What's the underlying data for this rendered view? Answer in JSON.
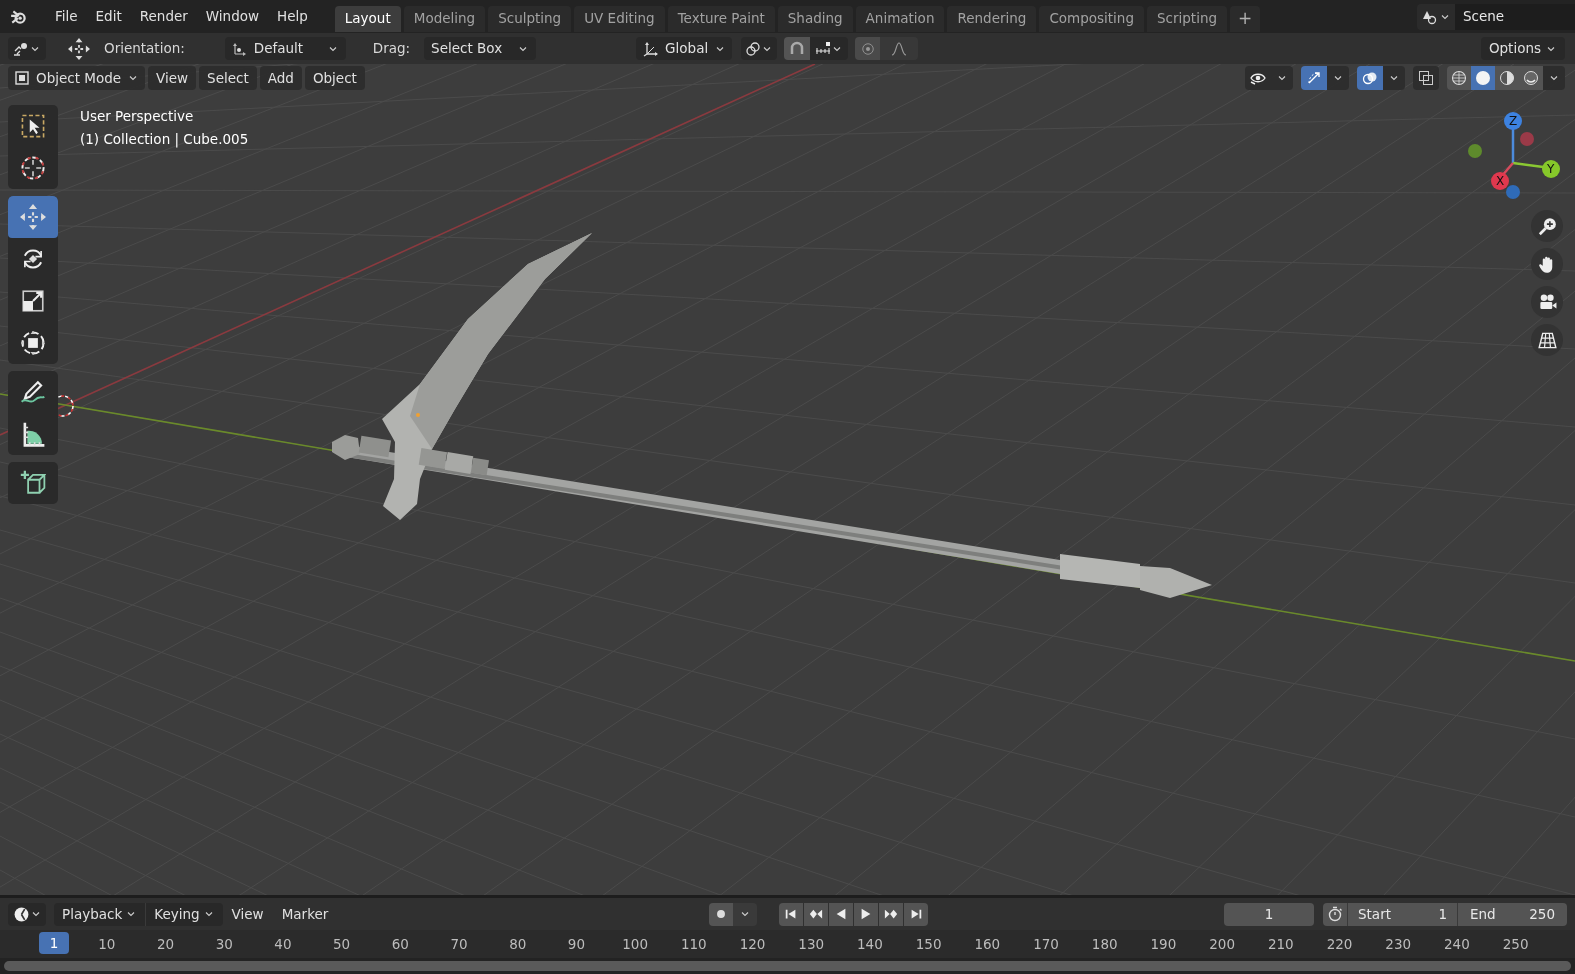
{
  "menu": [
    "File",
    "Edit",
    "Render",
    "Window",
    "Help"
  ],
  "workspaces": [
    {
      "label": "Layout",
      "selected": true
    },
    {
      "label": "Modeling",
      "selected": false
    },
    {
      "label": "Sculpting",
      "selected": false
    },
    {
      "label": "UV Editing",
      "selected": false
    },
    {
      "label": "Texture Paint",
      "selected": false
    },
    {
      "label": "Shading",
      "selected": false
    },
    {
      "label": "Animation",
      "selected": false
    },
    {
      "label": "Rendering",
      "selected": false
    },
    {
      "label": "Compositing",
      "selected": false
    },
    {
      "label": "Scripting",
      "selected": false
    }
  ],
  "add_workspace": "+",
  "scene": "Scene",
  "tool_header": {
    "orientation_label": "Orientation:",
    "orientation": "Default",
    "drag_label": "Drag:",
    "drag": "Select Box",
    "transform_orientation": "Global",
    "options": "Options"
  },
  "viewport_header": {
    "mode": "Object Mode",
    "menus": [
      "View",
      "Select",
      "Add",
      "Object"
    ],
    "toggles": [
      {
        "kind": "visibility",
        "on": false
      },
      {
        "kind": "gizmo",
        "on": true
      },
      {
        "kind": "overlay",
        "on": true
      },
      {
        "kind": "xray",
        "on": false
      }
    ],
    "shading": [
      {
        "kind": "wireframe",
        "selected": false
      },
      {
        "kind": "solid",
        "selected": true
      },
      {
        "kind": "material",
        "selected": false
      },
      {
        "kind": "rendered",
        "selected": false
      }
    ]
  },
  "viewport_info": [
    "User Perspective",
    "(1) Collection | Cube.005"
  ],
  "toolbar_groups": [
    {
      "tools": [
        {
          "kind": "select_box",
          "selected": false
        },
        {
          "kind": "cursor",
          "selected": false
        }
      ]
    },
    {
      "tools": [
        {
          "kind": "move",
          "selected": true
        },
        {
          "kind": "rotate",
          "selected": false
        },
        {
          "kind": "scale",
          "selected": false
        },
        {
          "kind": "transform",
          "selected": false
        }
      ]
    },
    {
      "tools": [
        {
          "kind": "annotate",
          "selected": false
        },
        {
          "kind": "measure",
          "selected": false
        }
      ]
    },
    {
      "tools": [
        {
          "kind": "add_cube",
          "selected": false
        }
      ]
    }
  ],
  "gizmo_axes": [
    "Z",
    "Y",
    "X"
  ],
  "timeline": {
    "menus": [
      {
        "label": "Playback",
        "kind": "dropdown"
      },
      {
        "label": "Keying",
        "kind": "dropdown"
      },
      {
        "label": "View",
        "kind": "plain"
      },
      {
        "label": "Marker",
        "kind": "plain"
      }
    ],
    "current_frame": "1",
    "start_label": "Start",
    "start": "1",
    "end_label": "End",
    "end": "250",
    "playhead": "1",
    "ticks": [
      "10",
      "20",
      "30",
      "40",
      "50",
      "60",
      "70",
      "80",
      "90",
      "100",
      "110",
      "120",
      "130",
      "140",
      "150",
      "160",
      "170",
      "180",
      "190",
      "200",
      "210",
      "220",
      "230",
      "240",
      "250"
    ]
  }
}
